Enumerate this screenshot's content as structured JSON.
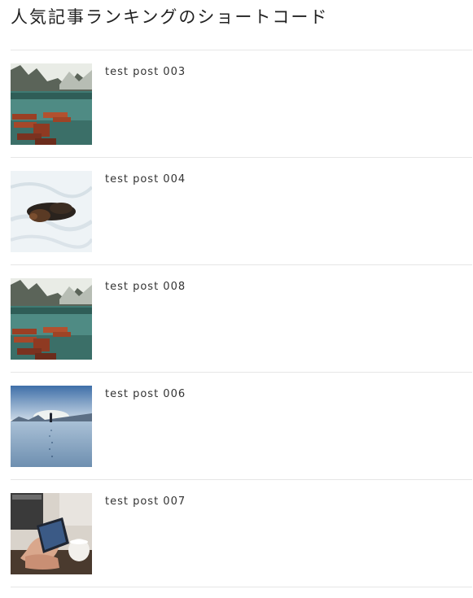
{
  "heading": "人気記事ランキングのショートコード",
  "posts": [
    {
      "title": "test post 003",
      "image": "lake-boats-mountains-image"
    },
    {
      "title": "test post 004",
      "image": "sleeping-puppy-image"
    },
    {
      "title": "test post 008",
      "image": "lake-boats-mountains-image"
    },
    {
      "title": "test post 006",
      "image": "snowy-field-person-image"
    },
    {
      "title": "test post 007",
      "image": "hand-smartphone-cafe-image"
    }
  ]
}
